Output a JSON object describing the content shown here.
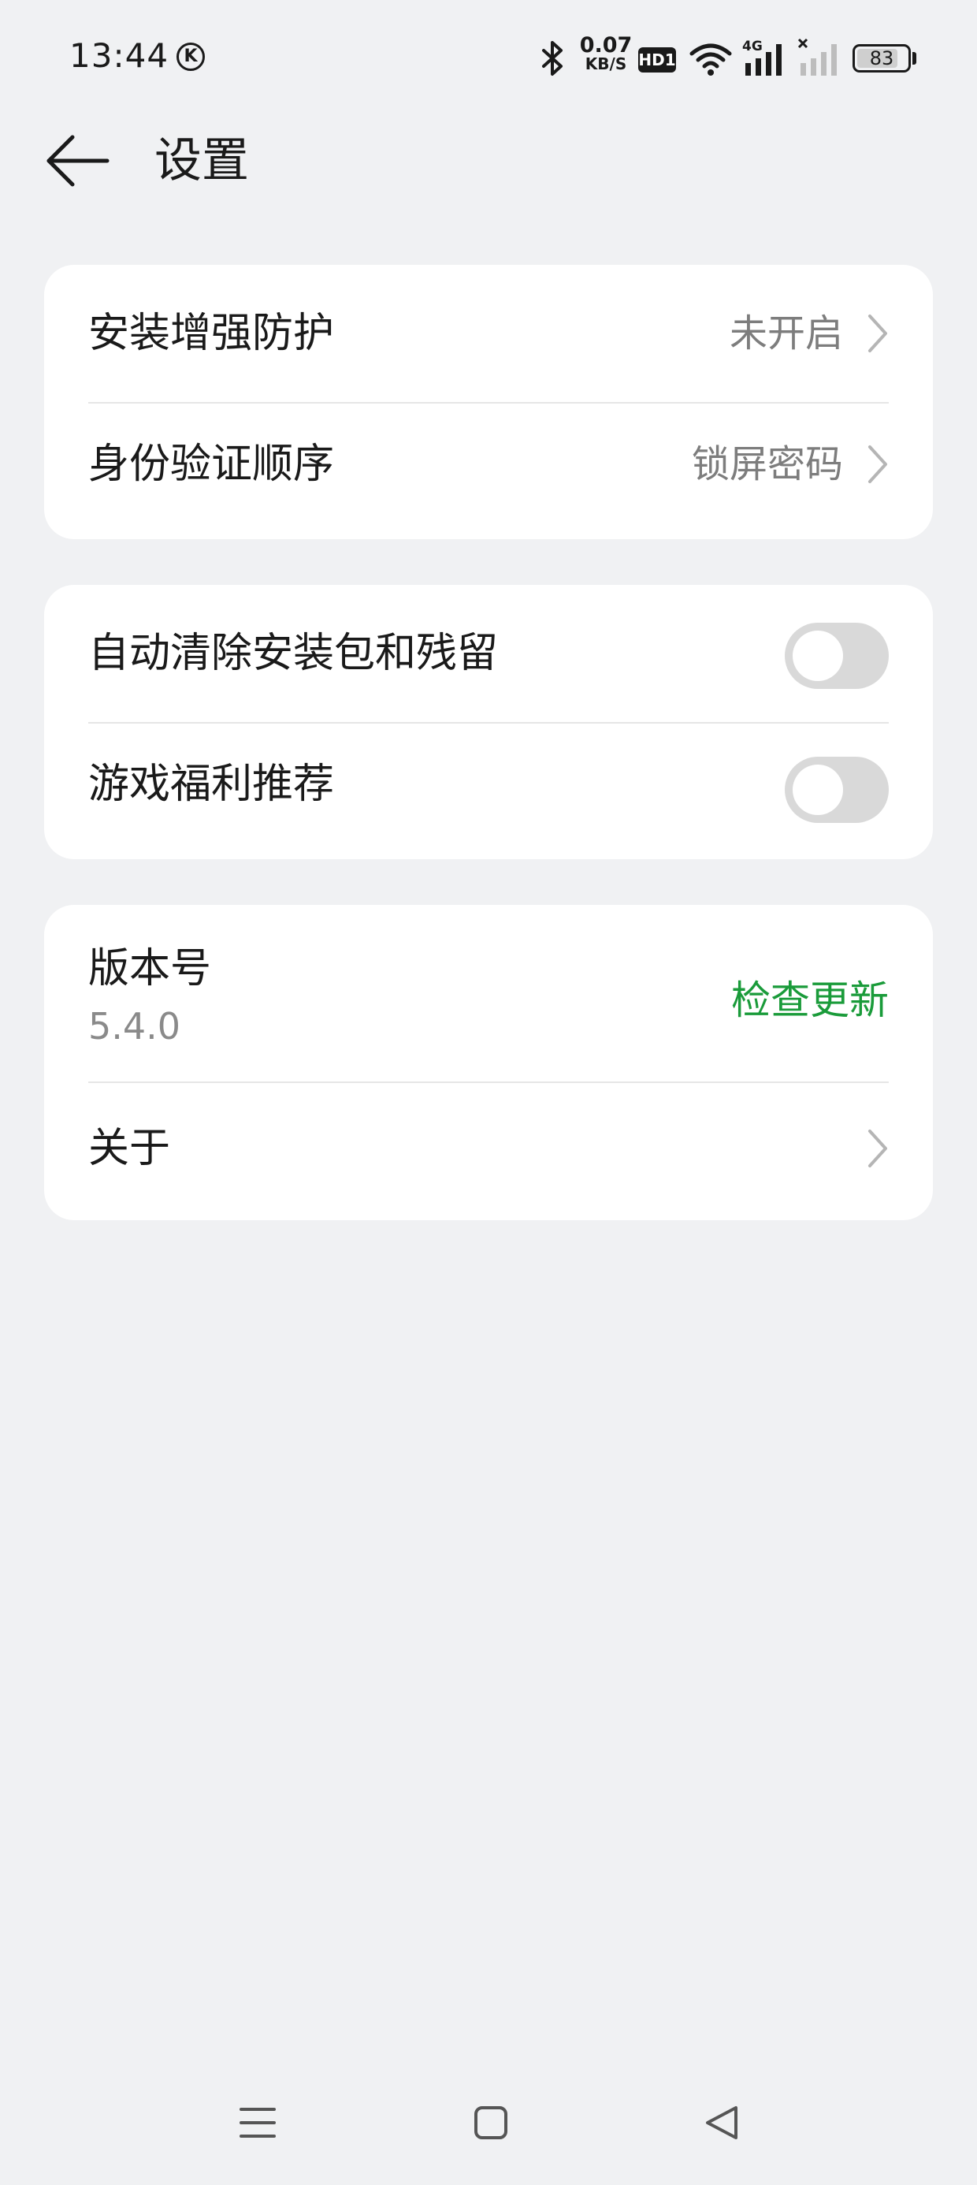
{
  "status_bar": {
    "time": "13:44",
    "k_badge": "K",
    "net_speed_value": "0.07",
    "net_speed_unit": "KB/S",
    "hd_label": "HD1",
    "signal_4g_label": "4G",
    "battery_level": "83"
  },
  "header": {
    "title": "设置"
  },
  "security_card": {
    "install_protection_label": "安装增强防护",
    "install_protection_value": "未开启",
    "auth_order_label": "身份验证顺序",
    "auth_order_value": "锁屏密码"
  },
  "toggles_card": {
    "auto_clean_label": "自动清除安装包和残留",
    "auto_clean_on": false,
    "game_recommend_label": "游戏福利推荐",
    "game_recommend_on": false
  },
  "about_card": {
    "version_label": "版本号",
    "version_number": "5.4.0",
    "check_update_label": "检查更新",
    "about_label": "关于"
  },
  "colors": {
    "background": "#f0f1f3",
    "card": "#ffffff",
    "accent_green": "#1a9b3a",
    "secondary_text": "#7d7d7d",
    "toggle_off": "#d9d9d9"
  },
  "icons": {
    "back": "arrow-left-icon",
    "chevron": "chevron-right-icon",
    "nav_menu": "menu-icon",
    "nav_home": "square-home-icon",
    "nav_back": "triangle-back-icon",
    "bluetooth": "bluetooth-icon",
    "wifi": "wifi-icon"
  }
}
